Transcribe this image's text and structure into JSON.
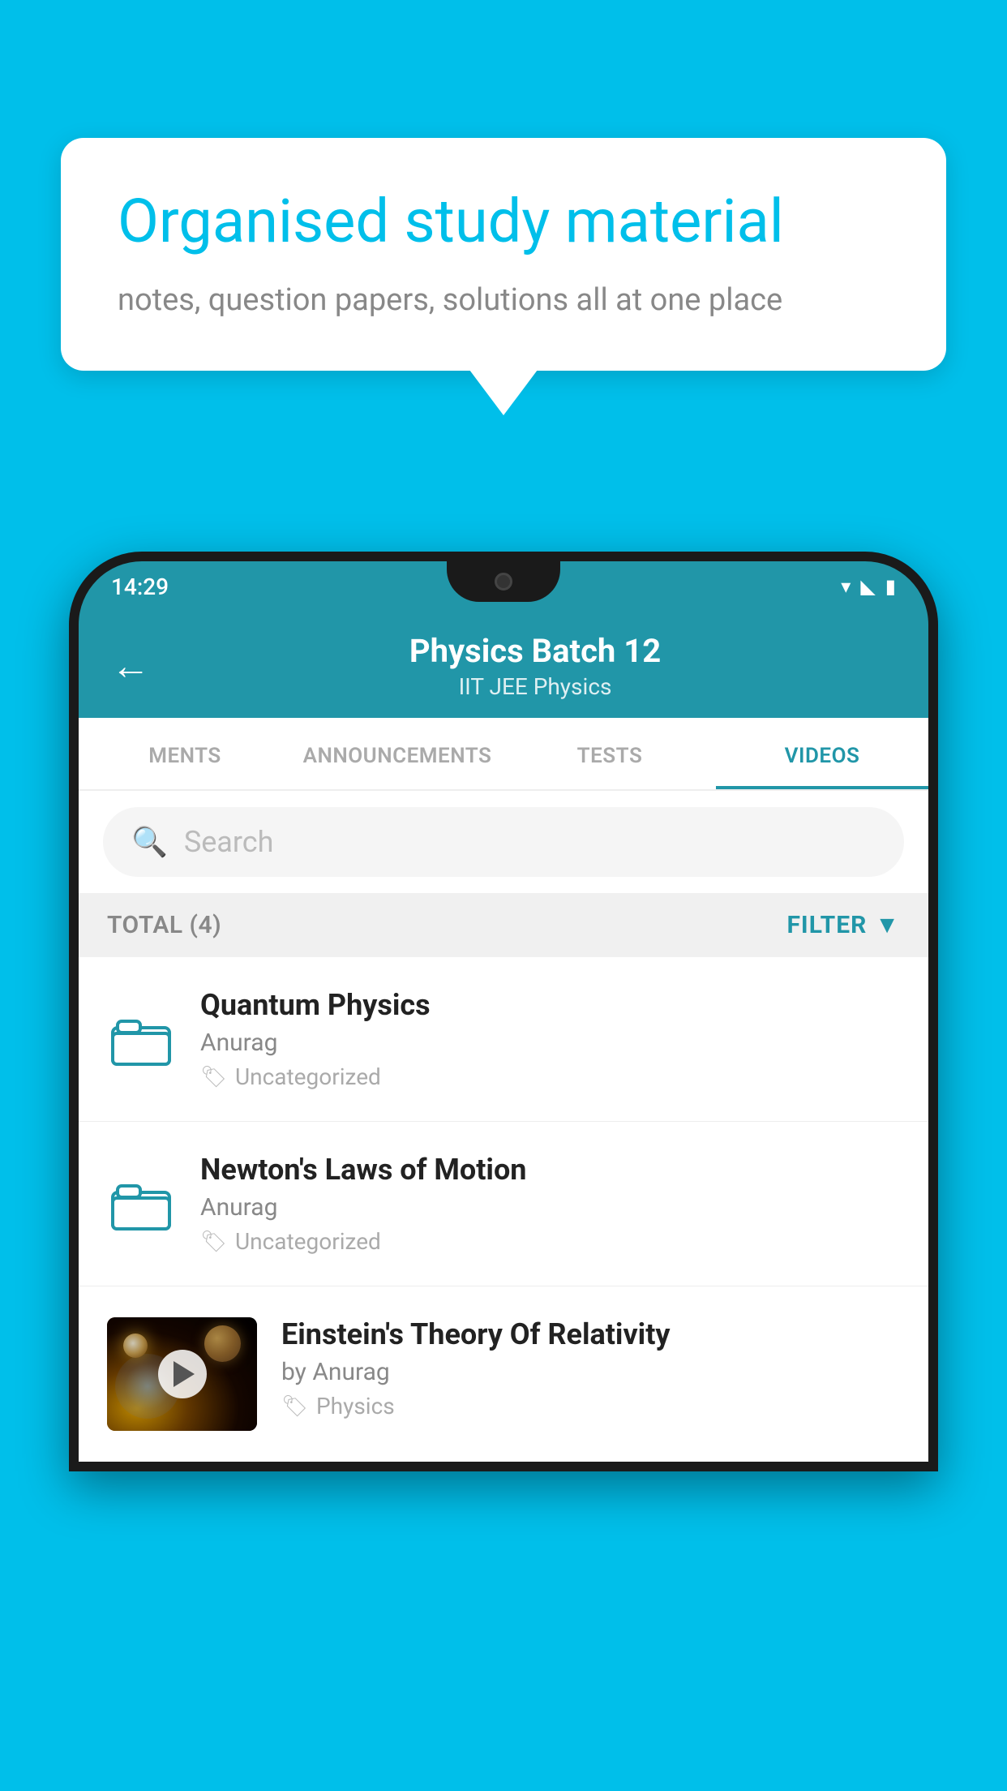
{
  "background": {
    "color": "#00BFEA"
  },
  "speech_bubble": {
    "heading": "Organised study material",
    "subtext": "notes, question papers, solutions all at one place"
  },
  "phone": {
    "time": "14:29",
    "header": {
      "back_label": "←",
      "title": "Physics Batch 12",
      "subtitle": "IIT JEE   Physics"
    },
    "tabs": [
      {
        "label": "MENTS",
        "active": false
      },
      {
        "label": "ANNOUNCEMENTS",
        "active": false
      },
      {
        "label": "TESTS",
        "active": false
      },
      {
        "label": "VIDEOS",
        "active": true
      }
    ],
    "search": {
      "placeholder": "Search"
    },
    "filter": {
      "total_label": "TOTAL (4)",
      "filter_label": "FILTER"
    },
    "items": [
      {
        "id": "quantum",
        "title": "Quantum Physics",
        "author": "Anurag",
        "tag": "Uncategorized",
        "has_thumbnail": false
      },
      {
        "id": "newton",
        "title": "Newton's Laws of Motion",
        "author": "Anurag",
        "tag": "Uncategorized",
        "has_thumbnail": false
      },
      {
        "id": "einstein",
        "title": "Einstein's Theory Of Relativity",
        "author": "by Anurag",
        "tag": "Physics",
        "has_thumbnail": true
      }
    ]
  }
}
